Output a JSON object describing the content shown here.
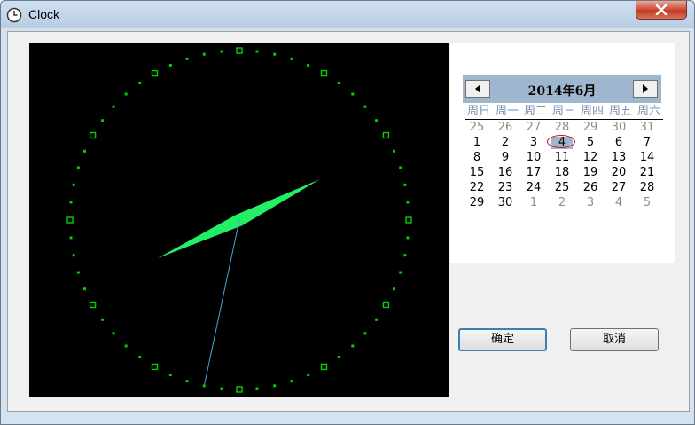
{
  "window": {
    "title": "Clock"
  },
  "calendar": {
    "title": "2014年6月",
    "weekdays": [
      "周日",
      "周一",
      "周二",
      "周三",
      "周四",
      "周五",
      "周六"
    ],
    "weeks": [
      [
        {
          "d": "25",
          "o": true
        },
        {
          "d": "26",
          "o": true
        },
        {
          "d": "27",
          "o": true
        },
        {
          "d": "28",
          "o": true
        },
        {
          "d": "29",
          "o": true
        },
        {
          "d": "30",
          "o": true
        },
        {
          "d": "31",
          "o": true
        }
      ],
      [
        {
          "d": "1"
        },
        {
          "d": "2"
        },
        {
          "d": "3"
        },
        {
          "d": "4",
          "sel": true
        },
        {
          "d": "5"
        },
        {
          "d": "6"
        },
        {
          "d": "7"
        }
      ],
      [
        {
          "d": "8"
        },
        {
          "d": "9"
        },
        {
          "d": "10"
        },
        {
          "d": "11"
        },
        {
          "d": "12"
        },
        {
          "d": "13"
        },
        {
          "d": "14"
        }
      ],
      [
        {
          "d": "15"
        },
        {
          "d": "16"
        },
        {
          "d": "17"
        },
        {
          "d": "18"
        },
        {
          "d": "19"
        },
        {
          "d": "20"
        },
        {
          "d": "21"
        }
      ],
      [
        {
          "d": "22"
        },
        {
          "d": "23"
        },
        {
          "d": "24"
        },
        {
          "d": "25"
        },
        {
          "d": "26"
        },
        {
          "d": "27"
        },
        {
          "d": "28"
        }
      ],
      [
        {
          "d": "29"
        },
        {
          "d": "30"
        },
        {
          "d": "1",
          "o": true
        },
        {
          "d": "2",
          "o": true
        },
        {
          "d": "3",
          "o": true
        },
        {
          "d": "4",
          "o": true
        },
        {
          "d": "5",
          "o": true
        }
      ]
    ],
    "prev_icon": "left-arrow-icon",
    "next_icon": "right-arrow-icon"
  },
  "clock": {
    "hour": 8,
    "minute": 10,
    "second": 32,
    "colors": {
      "face": "#000000",
      "marks": "#00d000",
      "hands": "#22ee66",
      "second_hand": "#3fa9d9"
    }
  },
  "buttons": {
    "ok": "确定",
    "cancel": "取消"
  }
}
